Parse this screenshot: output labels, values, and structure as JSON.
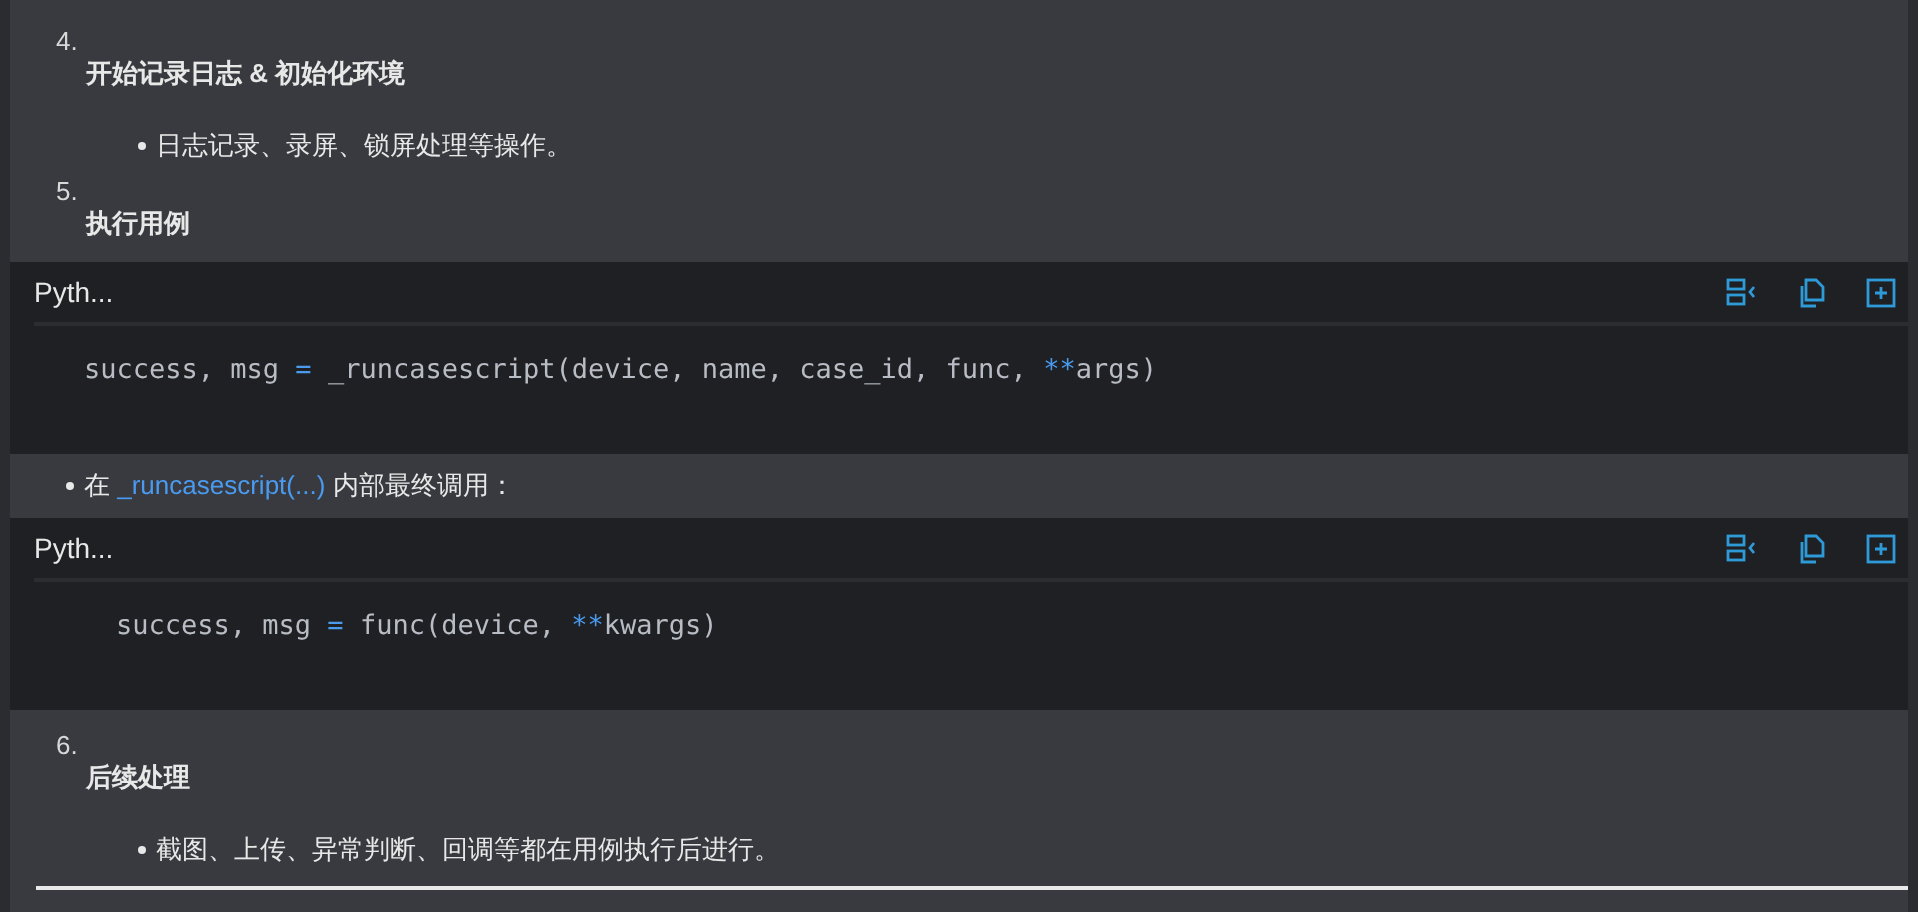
{
  "blocks": [
    {
      "kind": "step",
      "number": "4.",
      "title": "开始记录日志 & 初始化环境",
      "bullets": [
        "日志记录、录屏、锁屏处理等操作。"
      ]
    },
    {
      "kind": "step",
      "number": "5.",
      "title": "执行用例"
    },
    {
      "kind": "code",
      "language": "Pyth...",
      "indent": false,
      "tokens": [
        {
          "kind": "plain",
          "text": "success, msg "
        },
        {
          "kind": "operator",
          "text": "="
        },
        {
          "kind": "plain",
          "text": " _runcasescript(device, name, case_id, func, "
        },
        {
          "kind": "operator",
          "text": "**"
        },
        {
          "kind": "plain",
          "text": "args)"
        }
      ]
    },
    {
      "kind": "bullet",
      "parts": [
        {
          "kind": "text",
          "text": "在 "
        },
        {
          "kind": "code",
          "text": "_runcasescript(...)"
        },
        {
          "kind": "text",
          "text": " 内部最终调用："
        }
      ]
    },
    {
      "kind": "code",
      "language": "Pyth...",
      "indent": true,
      "tokens": [
        {
          "kind": "plain",
          "text": "success, msg "
        },
        {
          "kind": "operator",
          "text": "="
        },
        {
          "kind": "plain",
          "text": " func(device, "
        },
        {
          "kind": "operator",
          "text": "**"
        },
        {
          "kind": "plain",
          "text": "kwargs)"
        }
      ]
    },
    {
      "kind": "step",
      "number": "6.",
      "title": "后续处理",
      "bullets": [
        "截图、上传、异常判断、回调等都在用例执行后进行。"
      ]
    }
  ]
}
